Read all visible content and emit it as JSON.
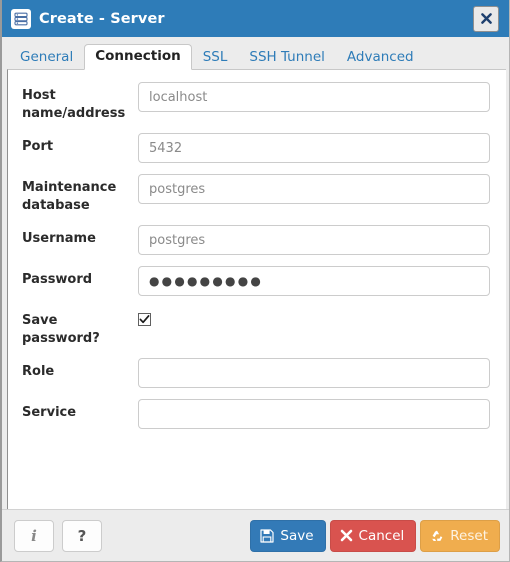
{
  "window": {
    "title": "Create - Server",
    "icon": "server-icon",
    "close_label": "✖",
    "titlebar_color": "#2e7cb8"
  },
  "tabs": [
    {
      "label": "General",
      "active": false
    },
    {
      "label": "Connection",
      "active": true
    },
    {
      "label": "SSL",
      "active": false
    },
    {
      "label": "SSH Tunnel",
      "active": false
    },
    {
      "label": "Advanced",
      "active": false
    }
  ],
  "form": {
    "fields": [
      {
        "label": "Host name/address",
        "value": "localhost",
        "placeholder": "",
        "type": "text"
      },
      {
        "label": "Port",
        "value": "5432",
        "placeholder": "",
        "type": "text"
      },
      {
        "label": "Maintenance database",
        "value": "postgres",
        "placeholder": "",
        "type": "text"
      },
      {
        "label": "Username",
        "value": "postgres",
        "placeholder": "",
        "type": "text"
      },
      {
        "label": "Password",
        "value": "●●●●●●●●●",
        "placeholder": "",
        "type": "password"
      },
      {
        "label": "Role",
        "value": "",
        "placeholder": "",
        "type": "text"
      },
      {
        "label": "Service",
        "value": "",
        "placeholder": "",
        "type": "text"
      }
    ],
    "save_password": {
      "label": "Save password?",
      "checked": true
    }
  },
  "footer": {
    "info_label": "i",
    "help_label": "?",
    "actions": [
      {
        "label": "Save",
        "icon": "floppy-disk-icon",
        "color": "#337ab7"
      },
      {
        "label": "Cancel",
        "icon": "close-x-icon",
        "color": "#d9534f"
      },
      {
        "label": "Reset",
        "icon": "recycle-icon",
        "color": "#f0ad4e"
      }
    ]
  }
}
